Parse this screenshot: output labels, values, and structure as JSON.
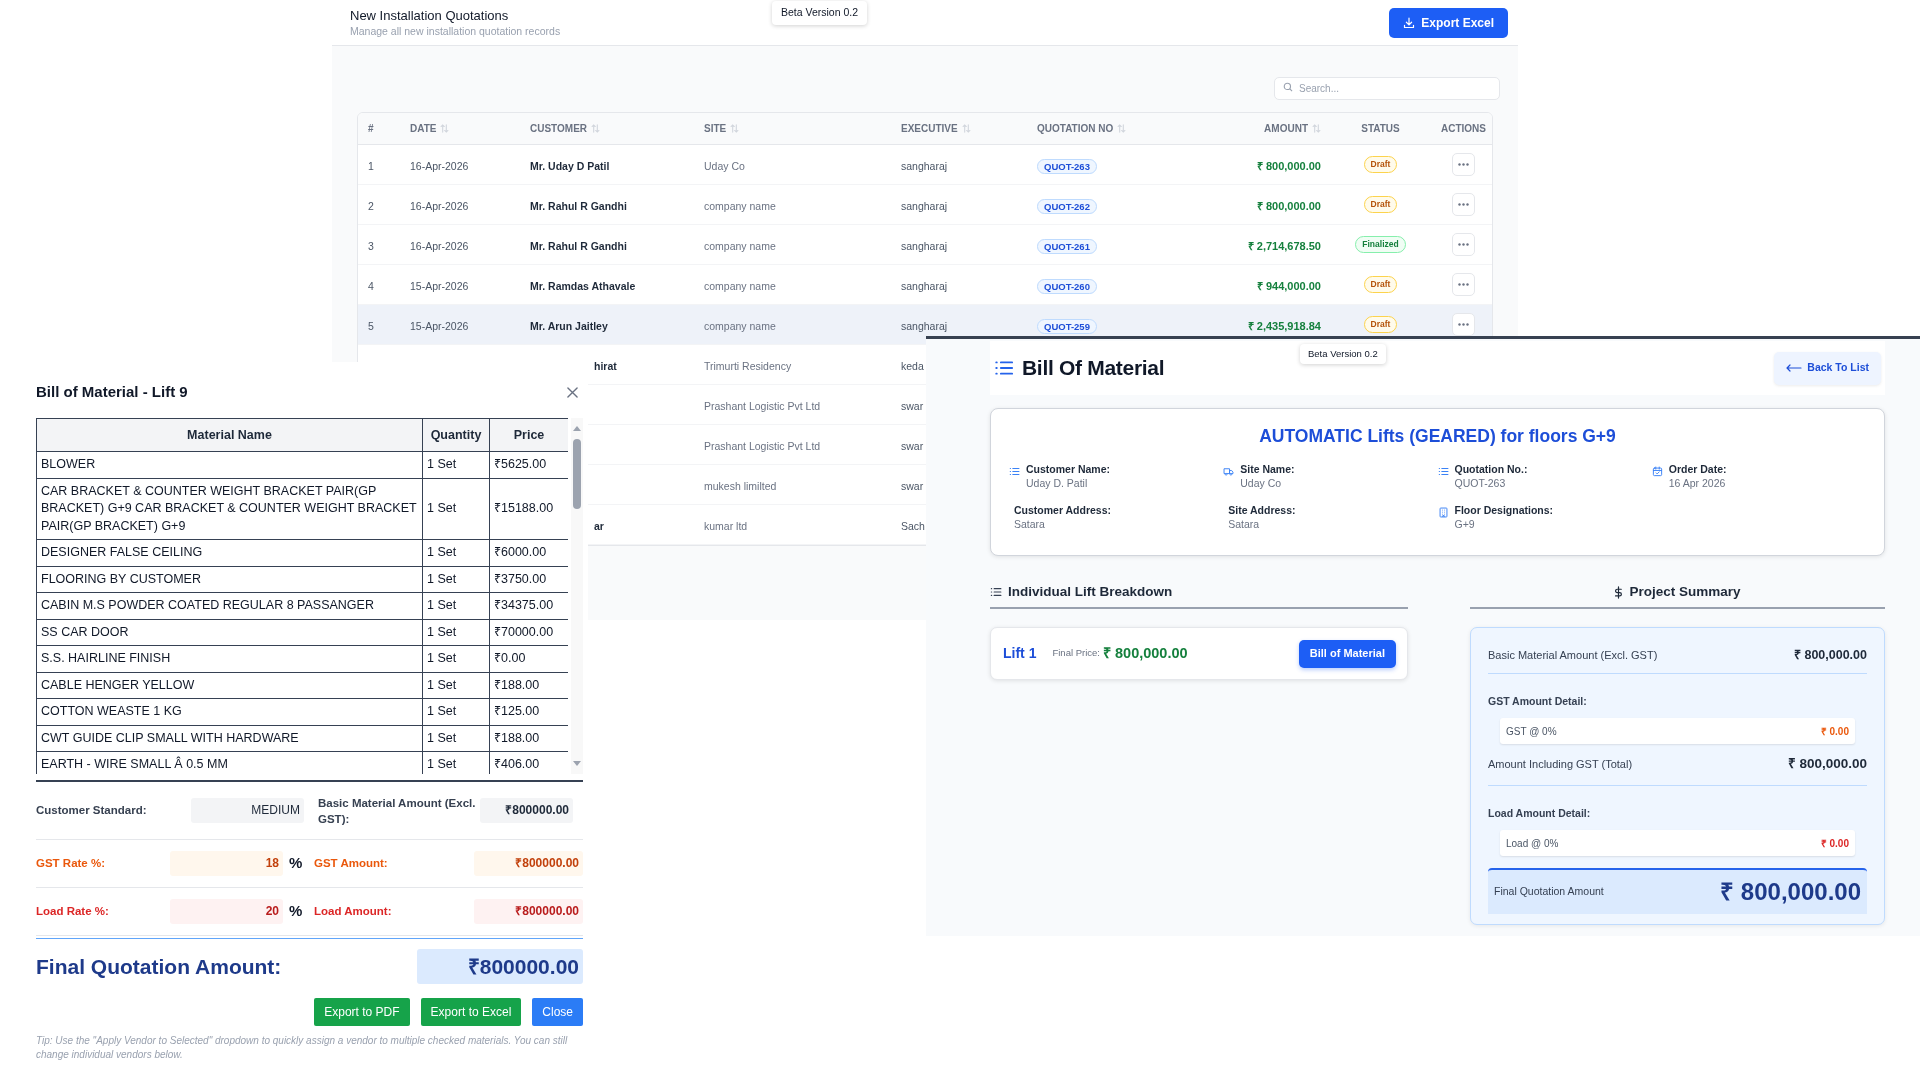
{
  "quotation_list": {
    "title": "New Installation Quotations",
    "subtitle": "Manage all new installation quotation records",
    "beta_badge": "Beta Version 0.2",
    "export_button": "Export Excel",
    "search": {
      "placeholder": "Search..."
    },
    "columns": [
      {
        "label": "#",
        "sortable": false
      },
      {
        "label": "DATE",
        "sortable": true
      },
      {
        "label": "CUSTOMER",
        "sortable": true
      },
      {
        "label": "SITE",
        "sortable": true
      },
      {
        "label": "EXECUTIVE",
        "sortable": true
      },
      {
        "label": "QUOTATION NO",
        "sortable": true
      },
      {
        "label": "AMOUNT",
        "sortable": true
      },
      {
        "label": "STATUS",
        "sortable": false
      },
      {
        "label": "ACTIONS",
        "sortable": false
      }
    ],
    "rows": [
      {
        "index": "1",
        "date": "16-Apr-2026",
        "customer": "Mr. Uday D Patil",
        "site": "Uday Co",
        "executive": "sangharaj",
        "quotation_no": "QUOT-263",
        "amount": "₹ 800,000.00",
        "status": {
          "label": "Draft",
          "kind": "draft"
        },
        "highlighted": false
      },
      {
        "index": "2",
        "date": "16-Apr-2026",
        "customer": "Mr. Rahul R Gandhi",
        "site": "company name",
        "executive": "sangharaj",
        "quotation_no": "QUOT-262",
        "amount": "₹ 800,000.00",
        "status": {
          "label": "Draft",
          "kind": "draft"
        },
        "highlighted": false
      },
      {
        "index": "3",
        "date": "16-Apr-2026",
        "customer": "Mr. Rahul R Gandhi",
        "site": "company name",
        "executive": "sangharaj",
        "quotation_no": "QUOT-261",
        "amount": "₹ 2,714,678.50",
        "status": {
          "label": "Finalized",
          "kind": "finalized"
        },
        "highlighted": false
      },
      {
        "index": "4",
        "date": "15-Apr-2026",
        "customer": "Mr. Ramdas Athavale",
        "site": "company name",
        "executive": "sangharaj",
        "quotation_no": "QUOT-260",
        "amount": "₹ 944,000.00",
        "status": {
          "label": "Draft",
          "kind": "draft"
        },
        "highlighted": false
      },
      {
        "index": "5",
        "date": "15-Apr-2026",
        "customer": "Mr. Arun Jaitley",
        "site": "company name",
        "executive": "sangharaj",
        "quotation_no": "QUOT-259",
        "amount": "₹ 2,435,918.84",
        "status": {
          "label": "Draft",
          "kind": "draft"
        },
        "highlighted": true
      }
    ],
    "partial_rows": [
      {
        "customer": "hirat",
        "site": "Trimurti Residency",
        "executive": "keda"
      },
      {
        "site": "Prashant Logistic Pvt Ltd",
        "executive": "swar"
      },
      {
        "site": "Prashant Logistic Pvt Ltd",
        "executive": "swar"
      },
      {
        "site": "mukesh limilted",
        "executive": "swar"
      },
      {
        "customer": "ar",
        "site": "kumar ltd",
        "executive": "Sach"
      }
    ]
  },
  "bom_modal": {
    "title": "Bill of Material - Lift 9",
    "columns": [
      "Material Name",
      "Quantity",
      "Price"
    ],
    "rows": [
      {
        "name": "BLOWER",
        "quantity": "1 Set",
        "price": "₹5625.00"
      },
      {
        "name": "CAR BRACKET & COUNTER WEIGHT BRACKET PAIR(GP BRACKET) G+9 CAR BRACKET & COUNTER WEIGHT BRACKET PAIR(GP BRACKET) G+9",
        "quantity": "1 Set",
        "price": "₹15188.00"
      },
      {
        "name": "DESIGNER FALSE CEILING",
        "quantity": "1 Set",
        "price": "₹6000.00"
      },
      {
        "name": "FLOORING BY CUSTOMER",
        "quantity": "1 Set",
        "price": "₹3750.00"
      },
      {
        "name": "CABIN M.S POWDER COATED REGULAR 8 PASSANGER",
        "quantity": "1 Set",
        "price": "₹34375.00"
      },
      {
        "name": "SS CAR DOOR",
        "quantity": "1 Set",
        "price": "₹70000.00"
      },
      {
        "name": "S.S. HAIRLINE FINISH",
        "quantity": "1 Set",
        "price": "₹0.00"
      },
      {
        "name": "CABLE HENGER YELLOW",
        "quantity": "1 Set",
        "price": "₹188.00"
      },
      {
        "name": "COTTON WEASTE 1 KG",
        "quantity": "1 Set",
        "price": "₹125.00"
      },
      {
        "name": "CWT GUIDE CLIP SMALL WITH HARDWARE",
        "quantity": "1 Set",
        "price": "₹188.00"
      },
      {
        "name": "EARTH - WIRE SMALL Â 0.5 MM",
        "quantity": "1 Set",
        "price": "₹406.00"
      }
    ],
    "customer_standard": {
      "label": "Customer Standard:",
      "value": "MEDIUM"
    },
    "basic_amount": {
      "label": "Basic Material Amount (Excl. GST):",
      "value": "₹800000.00"
    },
    "gst_rate": {
      "label": "GST Rate %:",
      "value": "18",
      "unit": "%"
    },
    "gst_amount": {
      "label": "GST Amount:",
      "value": "₹800000.00"
    },
    "load_rate": {
      "label": "Load Rate %:",
      "value": "20",
      "unit": "%"
    },
    "load_amount": {
      "label": "Load Amount:",
      "value": "₹800000.00"
    },
    "final": {
      "label": "Final Quotation Amount:",
      "value": "₹800000.00"
    },
    "buttons": [
      {
        "label": "Export to PDF",
        "kind": "success"
      },
      {
        "label": "Export to Excel",
        "kind": "success"
      },
      {
        "label": "Close",
        "kind": "primary"
      }
    ],
    "tip": "Tip: Use the \"Apply Vendor to Selected\" dropdown to quickly assign a vendor to multiple checked materials. You can still change individual vendors below."
  },
  "bom_page": {
    "title": "Bill Of Material",
    "beta_badge": "Beta Version 0.2",
    "back_button": "Back To List",
    "project_title": "AUTOMATIC Lifts (GEARED) for floors G+9",
    "info": [
      {
        "label": "Customer Name:",
        "value": "Uday D. Patil",
        "kind": "list"
      },
      {
        "label": "Site Name:",
        "value": "Uday Co",
        "kind": "truck"
      },
      {
        "label": "Quotation No.:",
        "value": "QUOT-263",
        "kind": "list"
      },
      {
        "label": "Order Date:",
        "value": "16 Apr 2026",
        "kind": "calendar"
      },
      {
        "label": "Customer Address:",
        "value": "Satara"
      },
      {
        "label": "Site Address:",
        "value": "Satara"
      },
      {
        "label": "Floor Designations:",
        "value": "G+9",
        "kind": "building"
      }
    ],
    "breakdown_heading": "Individual Lift Breakdown",
    "summary_heading": "Project Summary",
    "lifts": [
      {
        "name": "Lift 1",
        "price_label": "Final Price:",
        "price": "₹ 800,000.00",
        "button": "Bill of Material"
      }
    ],
    "summary": {
      "basic": {
        "label": "Basic Material Amount (Excl. GST)",
        "value": "₹ 800,000.00"
      },
      "gst_heading": "GST Amount Detail:",
      "gst_line": {
        "label": "GST @ 0%",
        "value": "₹ 0.00"
      },
      "including": {
        "label": "Amount Including GST (Total)",
        "value": "₹ 800,000.00"
      },
      "load_heading": "Load Amount Detail:",
      "load_line": {
        "label": "Load @ 0%",
        "value": "₹ 0.00"
      },
      "final": {
        "label": "Final Quotation Amount",
        "value": "₹ 800,000.00"
      }
    }
  }
}
